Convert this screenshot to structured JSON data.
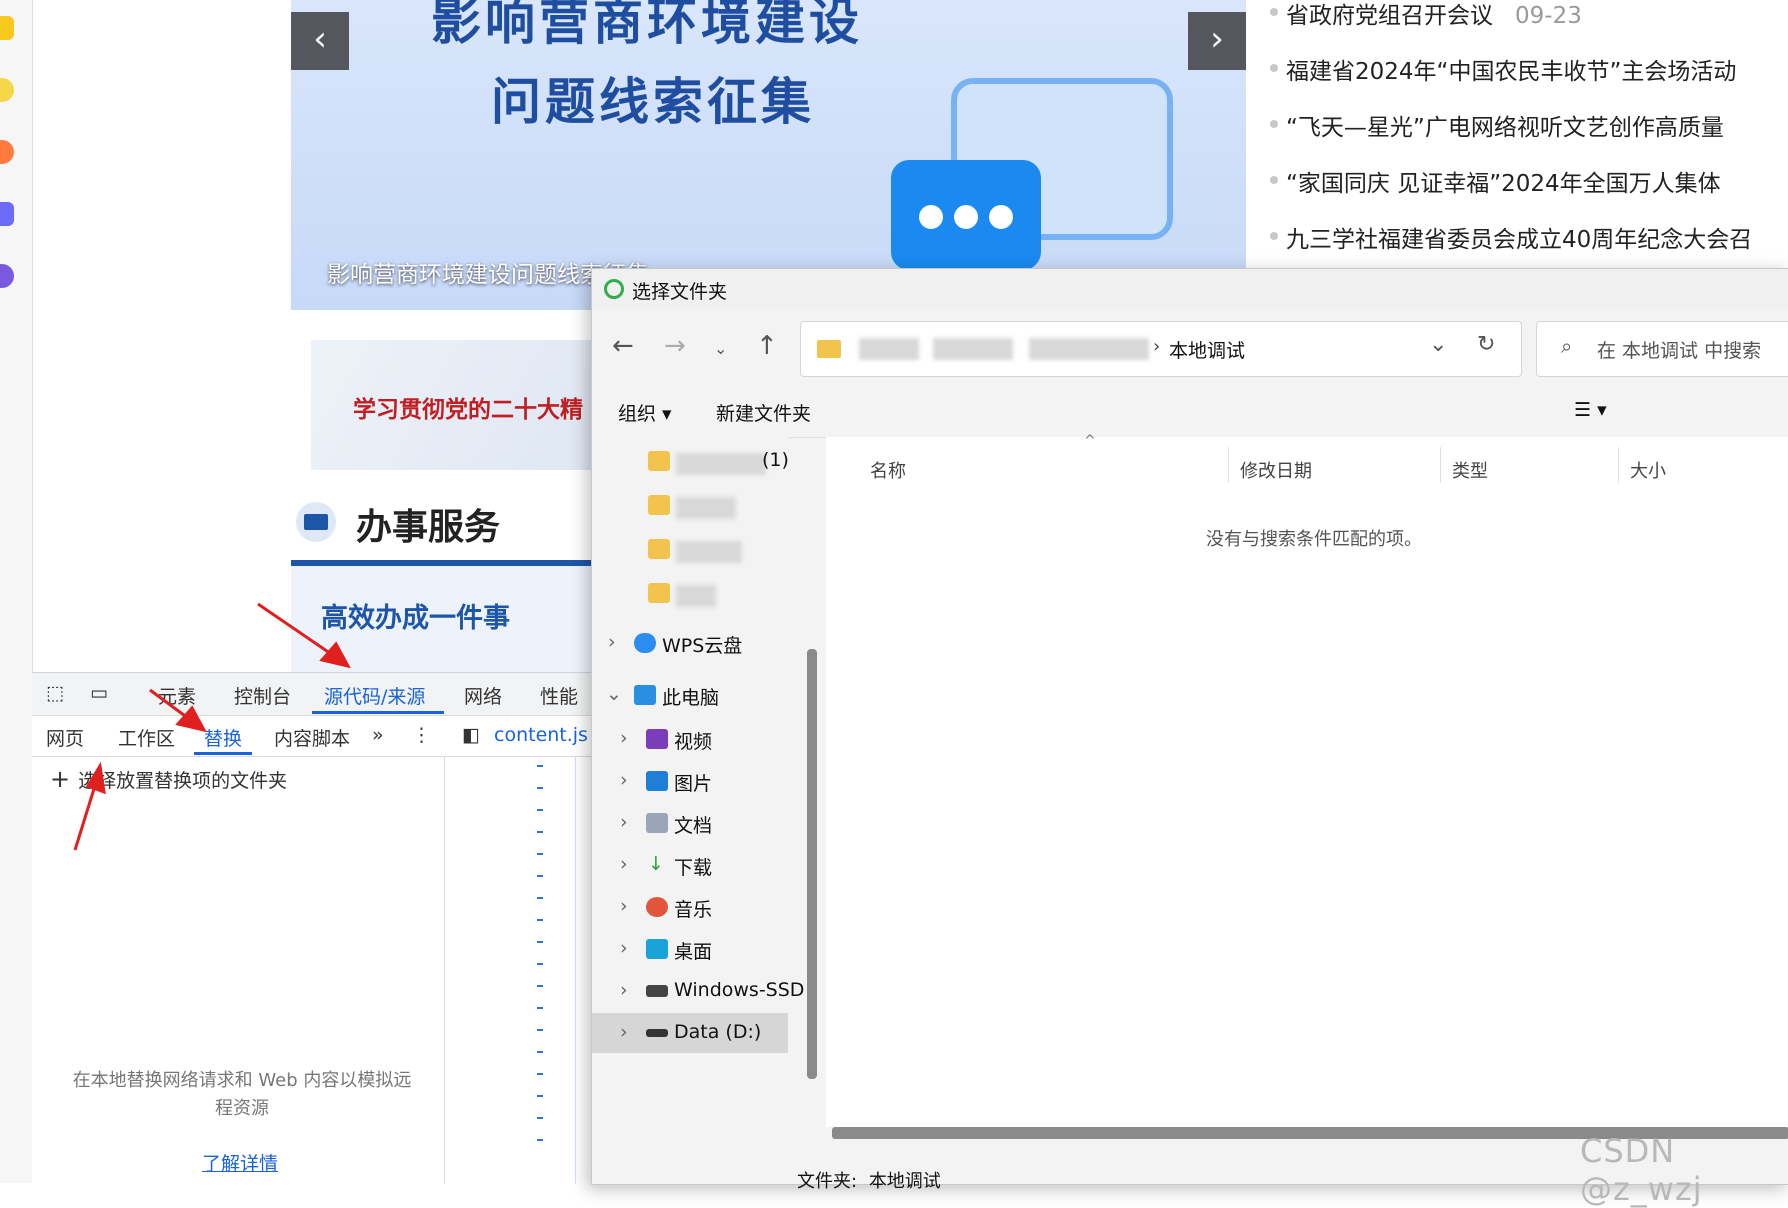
{
  "banner": {
    "title_line1": "影响营商环境建设",
    "title_line2": "问题线索征集",
    "caption": "影响营商环境建设问题线索征集",
    "prev_label": "‹",
    "next_label": "›"
  },
  "news": [
    {
      "title": "省政府党组召开会议",
      "date": "09-23"
    },
    {
      "title": "福建省2024年“中国农民丰收节”主会场活动",
      "date": ""
    },
    {
      "title": "“飞天—星光”广电网络视听文艺创作高质量",
      "date": ""
    },
    {
      "title": "“家国同庆 见证幸福”2024年全国万人集体",
      "date": ""
    },
    {
      "title": "九三学社福建省委员会成立40周年纪念大会召",
      "date": ""
    }
  ],
  "study_banner": "学习贯彻党的二十大精",
  "service": {
    "title": "办事服务",
    "subtitle": "高效办成一件事"
  },
  "devtools": {
    "tabs": [
      "元素",
      "控制台",
      "源代码/来源",
      "网络",
      "性能"
    ],
    "subtabs": [
      "网页",
      "工作区",
      "替换",
      "内容脚本"
    ],
    "more": "»",
    "menu": "⋮",
    "file_tab": "content.js",
    "select_folder": "选择放置替换项的文件夹",
    "empty_message": "在本地替换网络请求和 Web 内容以模拟远程资源",
    "learn_more": "了解详情"
  },
  "dialog": {
    "title": "选择文件夹",
    "address_current": "本地调试",
    "search_placeholder": "在 本地调试 中搜索",
    "toolbar": {
      "organize": "组织",
      "new_folder": "新建文件夹"
    },
    "tree": [
      {
        "label": "(1)",
        "icon": "folder-icon",
        "blurred": true
      },
      {
        "label": "",
        "icon": "folder-icon",
        "blurred": true
      },
      {
        "label": "",
        "icon": "folder-icon",
        "blurred": true
      },
      {
        "label": "",
        "icon": "folder-icon",
        "blurred": true
      },
      {
        "label": "WPS云盘",
        "icon": "cloud-icon"
      },
      {
        "label": "此电脑",
        "icon": "computer-icon"
      },
      {
        "label": "视频",
        "icon": "video-icon"
      },
      {
        "label": "图片",
        "icon": "picture-icon"
      },
      {
        "label": "文档",
        "icon": "document-icon"
      },
      {
        "label": "下载",
        "icon": "download-icon"
      },
      {
        "label": "音乐",
        "icon": "music-icon"
      },
      {
        "label": "桌面",
        "icon": "desktop-icon"
      },
      {
        "label": "Windows-SSD",
        "icon": "drive-icon"
      },
      {
        "label": "Data (D:)",
        "icon": "drive-icon",
        "selected": true
      }
    ],
    "columns": [
      "名称",
      "修改日期",
      "类型",
      "大小"
    ],
    "empty_message": "没有与搜索条件匹配的项。",
    "footer_label": "文件夹:",
    "footer_value": "本地调试"
  },
  "watermark": "CSDN @z_wzj",
  "colors": {
    "accent": "#1a63d8",
    "banner_title": "#1f4ea1",
    "annotation": "#e0201f"
  }
}
